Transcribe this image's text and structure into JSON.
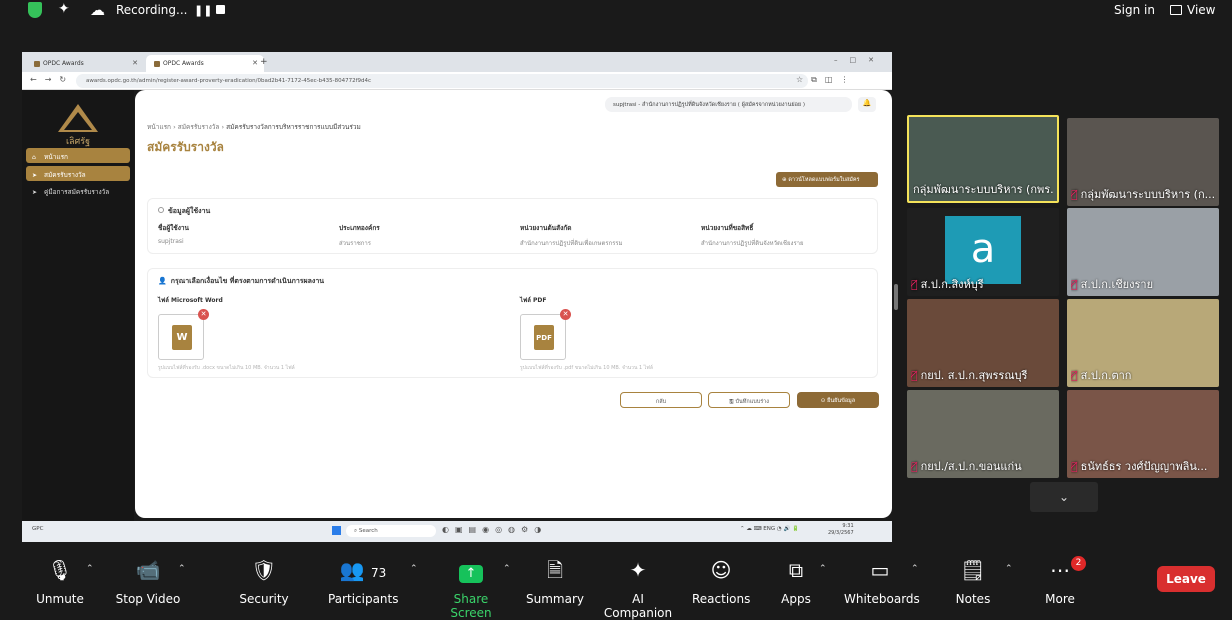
{
  "zoom_top": {
    "recording": "Recording...",
    "signin": "Sign in",
    "view": "View"
  },
  "browser": {
    "tabs": [
      "OPDC Awards",
      "OPDC Awards"
    ],
    "url": "awards.opdc.go.th/admin/register-award-proverty-eradication/0bad2b41-7172-45ec-b435-804772f9d4c"
  },
  "app": {
    "logo_text": "เลิศรัฐ",
    "menu": [
      "หน้าแรก",
      "สมัครรับรางวัล",
      "คู่มือการสมัครรับรางวัล"
    ],
    "user_pill": "supjtrasi - สำนักงานการปฏิรูปที่ดินจังหวัดเชียงราย ( ผู้สมัครจากหน่วยงานย่อย )",
    "breadcrumb": [
      "หน้าแรก",
      "สมัครรับรางวัล",
      "สมัครรับรางวัลการบริหารราชการแบบมีส่วนร่วม"
    ],
    "page_title": "สมัครรับรางวัล",
    "download_btn": "ดาวน์โหลดแบบฟอร์มใบสมัคร",
    "user_info": {
      "title": "ข้อมูลผู้ใช้งาน",
      "fields": [
        {
          "label": "ชื่อผู้ใช้งาน",
          "value": "supjtrasi"
        },
        {
          "label": "ประเภทองค์กร",
          "value": "ส่วนราชการ"
        },
        {
          "label": "หน่วยงานต้นสังกัด",
          "value": "สำนักงานการปฏิรูปที่ดินเพื่อเกษตรกรรม"
        },
        {
          "label": "หน่วยงานที่ขอสิทธิ์",
          "value": "สำนักงานการปฏิรูปที่ดินจังหวัดเชียงราย"
        }
      ]
    },
    "upload": {
      "title": "กรุณาเลือกเงื่อนไข ที่ตรงตามการดำเนินการผลงาน",
      "word_label": "ไฟล์ Microsoft Word",
      "pdf_label": "ไฟล์ PDF",
      "word_icon": "W",
      "pdf_icon": "PDF",
      "word_hint": "รูปแบบไฟล์ที่รองรับ .docx ขนาดไม่เกิน 10 MB. จำนวน 1 ไฟล์",
      "pdf_hint": "รูปแบบไฟล์ที่รองรับ .pdf ขนาดไม่เกิน 10 MB. จำนวน 1 ไฟล์"
    },
    "buttons": {
      "back": "กลับ",
      "draft": "บันทึกแบบร่าง",
      "save": "ยืนยันข้อมูล"
    }
  },
  "taskbar": {
    "weather": "GPC",
    "search": "Search",
    "lang": "ENG",
    "time": "9:31",
    "date": "29/3/2567"
  },
  "participants": [
    {
      "name": "กลุ่มพัฒนาระบบบริหาร (กพร. ...",
      "speaking": true
    },
    {
      "name": "กลุ่มพัฒนาระบบบริหาร (ก...",
      "speaking": false
    },
    {
      "name": "ส.ป.ก.สิงห์บุรี",
      "speaking": false,
      "avatar": "a"
    },
    {
      "name": "ส.ป.ก.เชียงราย",
      "speaking": false
    },
    {
      "name": "กยป. ส.ป.ก.สุพรรณบุรี",
      "speaking": false
    },
    {
      "name": "ส.ป.ก.ตาก",
      "speaking": false
    },
    {
      "name": "กยป./ส.ป.ก.ขอนแก่น",
      "speaking": false
    },
    {
      "name": "ธนัทธ์ธร วงศ์ปัญญาพลิน...",
      "speaking": false
    }
  ],
  "toolbar": {
    "unmute": "Unmute",
    "stop_video": "Stop Video",
    "security": "Security",
    "participants": "Participants",
    "participants_count": "73",
    "share_screen": "Share Screen",
    "summary": "Summary",
    "ai_companion": "AI Companion",
    "reactions": "Reactions",
    "apps": "Apps",
    "whiteboards": "Whiteboards",
    "notes": "Notes",
    "more": "More",
    "more_badge": "2",
    "leave": "Leave"
  }
}
